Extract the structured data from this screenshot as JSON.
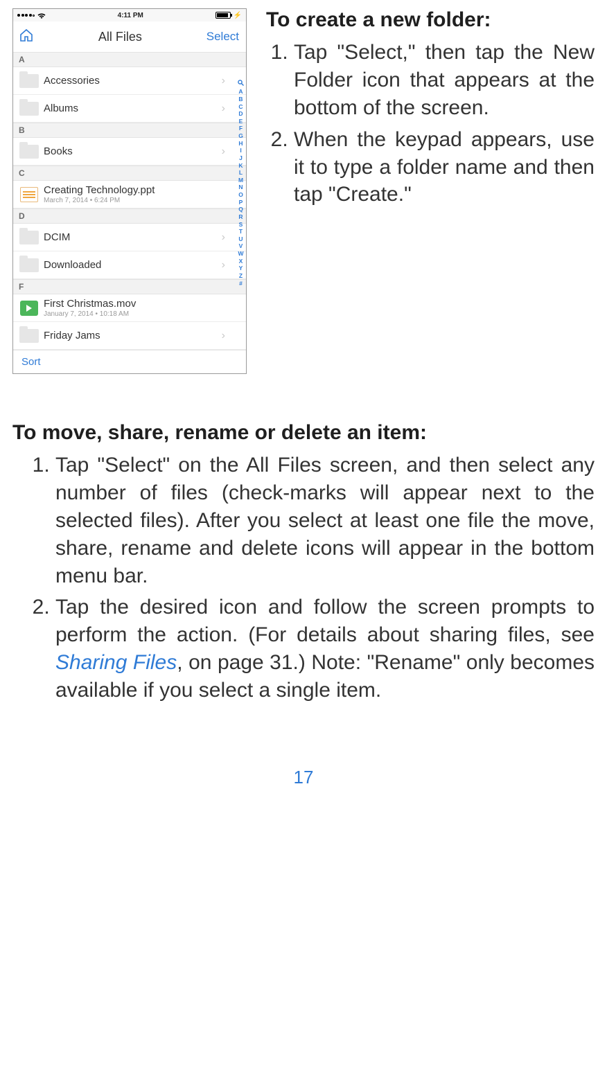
{
  "screenshot": {
    "status": {
      "time": "4:11 PM"
    },
    "nav": {
      "title": "All Files",
      "select": "Select"
    },
    "sections": [
      {
        "letter": "A",
        "rows": [
          {
            "kind": "folder",
            "name": "Accessories",
            "chevron": true
          },
          {
            "kind": "folder",
            "name": "Albums",
            "chevron": true
          }
        ]
      },
      {
        "letter": "B",
        "rows": [
          {
            "kind": "folder",
            "name": "Books",
            "chevron": true
          }
        ]
      },
      {
        "letter": "C",
        "rows": [
          {
            "kind": "ppt",
            "name": "Creating Technology.ppt",
            "meta": "March 7, 2014 • 6:24 PM"
          }
        ]
      },
      {
        "letter": "D",
        "rows": [
          {
            "kind": "folder",
            "name": "DCIM",
            "chevron": true
          },
          {
            "kind": "folder",
            "name": "Downloaded",
            "chevron": true
          }
        ]
      },
      {
        "letter": "F",
        "rows": [
          {
            "kind": "video",
            "name": "First Christmas.mov",
            "meta": "January 7, 2014 • 10:18 AM"
          },
          {
            "kind": "folder",
            "name": "Friday Jams",
            "chevron": true
          }
        ]
      }
    ],
    "footer": {
      "sort": "Sort"
    },
    "index": [
      "A",
      "B",
      "C",
      "D",
      "E",
      "F",
      "G",
      "H",
      "I",
      "J",
      "K",
      "L",
      "M",
      "N",
      "O",
      "P",
      "Q",
      "R",
      "S",
      "T",
      "U",
      "V",
      "W",
      "X",
      "Y",
      "Z",
      "#"
    ]
  },
  "rightBlock": {
    "heading": "To create a new folder:",
    "steps": [
      "Tap \"Select,\" then tap the New Folder icon that appears at the bottom of the screen.",
      "When the keypad appears, use it to type a folder name and then tap \"Create.\""
    ]
  },
  "lowerBlock": {
    "heading": "To move, share, rename or delete an item:",
    "step1": "Tap \"Select\" on the All Files screen, and then select any number of files (check-marks will appear next to the selected files). After you select at least one file the move, share, rename and delete icons will appear in the bottom menu bar.",
    "step2_pre": "Tap the desired icon and follow the screen prompts to perform the action. (For details about sharing files, see ",
    "step2_link": "Sharing Files",
    "step2_post": ", on page 31.) Note: \"Rename\" only becomes available if you select a single item."
  },
  "pageNumber": "17"
}
